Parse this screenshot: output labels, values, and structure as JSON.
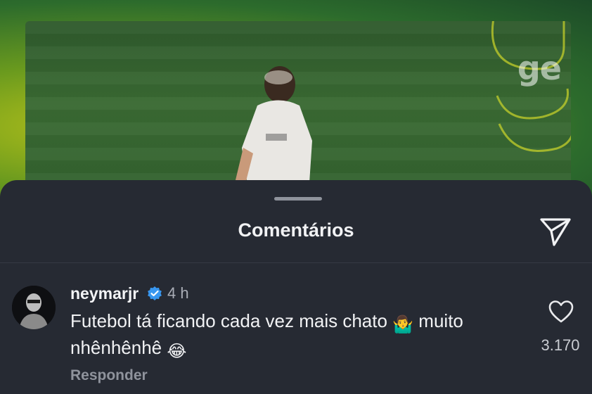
{
  "video": {
    "watermark": "ge"
  },
  "sheet": {
    "title": "Comentários",
    "send_icon": "send-icon"
  },
  "comment": {
    "username": "neymarjr",
    "verified_icon": "verified-badge-icon",
    "time": "4 h",
    "text_part1": "Futebol tá ficando cada vez mais chato",
    "emoji1": "🤷‍♂️",
    "text_part2": "muito",
    "text_part3": "nhênhênhê",
    "emoji2": "😂",
    "reply_label": "Responder",
    "likes": "3.170",
    "like_icon": "heart-icon"
  },
  "colors": {
    "sheet_bg": "#262a33",
    "verified_blue": "#3897f0"
  }
}
